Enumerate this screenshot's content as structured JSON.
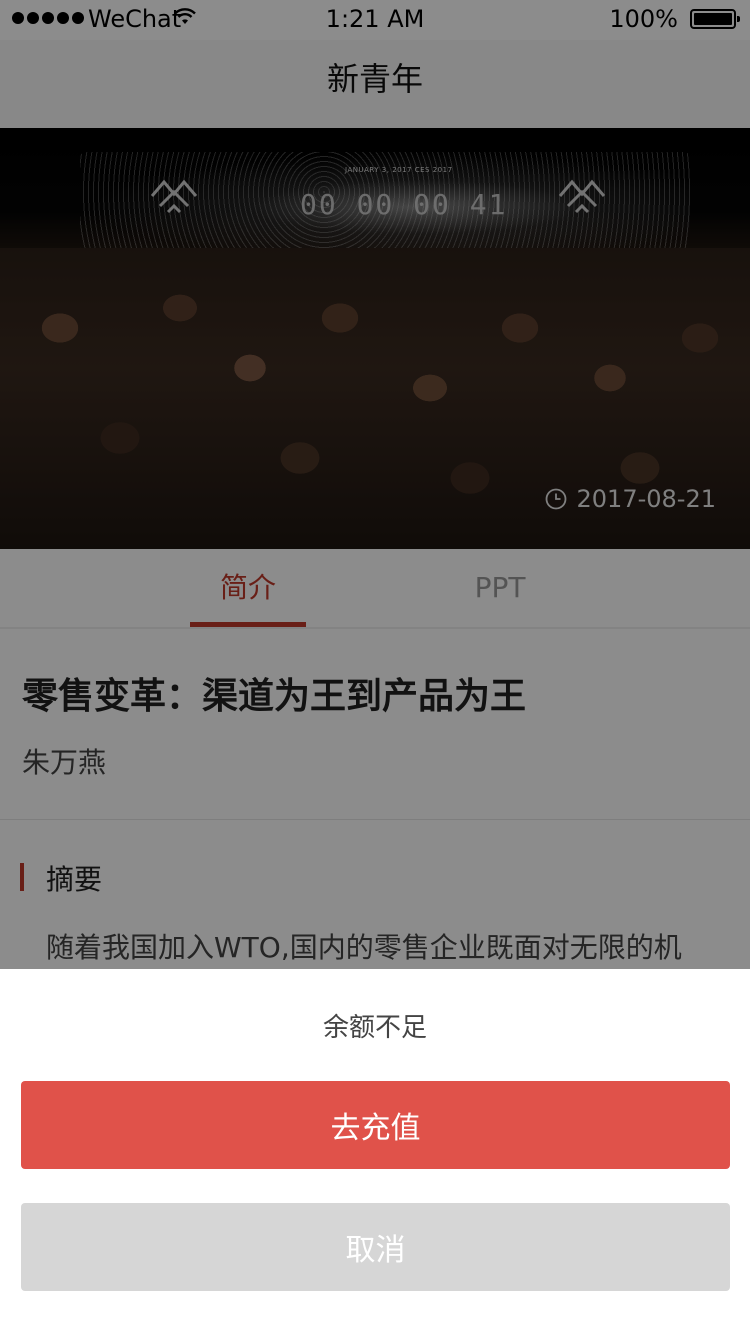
{
  "status_bar": {
    "carrier": "WeChat",
    "time": "1:21 AM",
    "battery": "100%"
  },
  "nav": {
    "title": "新青年"
  },
  "hero": {
    "date": "2017-08-21",
    "event_date_text": "JANUARY 3, 2017   CES 2017",
    "countdown": "00 00 00 41"
  },
  "tabs": [
    {
      "label": "简介",
      "active": true
    },
    {
      "label": "PPT",
      "active": false
    }
  ],
  "article": {
    "title": "零售变革：渠道为王到产品为王",
    "author": "朱万燕",
    "section_title": "摘要",
    "summary": "随着我国加入WTO,国内的零售企业既面对无限的机"
  },
  "sheet": {
    "message": "余额不足",
    "confirm_label": "去充值",
    "cancel_label": "取消"
  },
  "colors": {
    "accent": "#c0392b",
    "confirm": "#e0524a",
    "cancel": "#d6d6d6"
  }
}
